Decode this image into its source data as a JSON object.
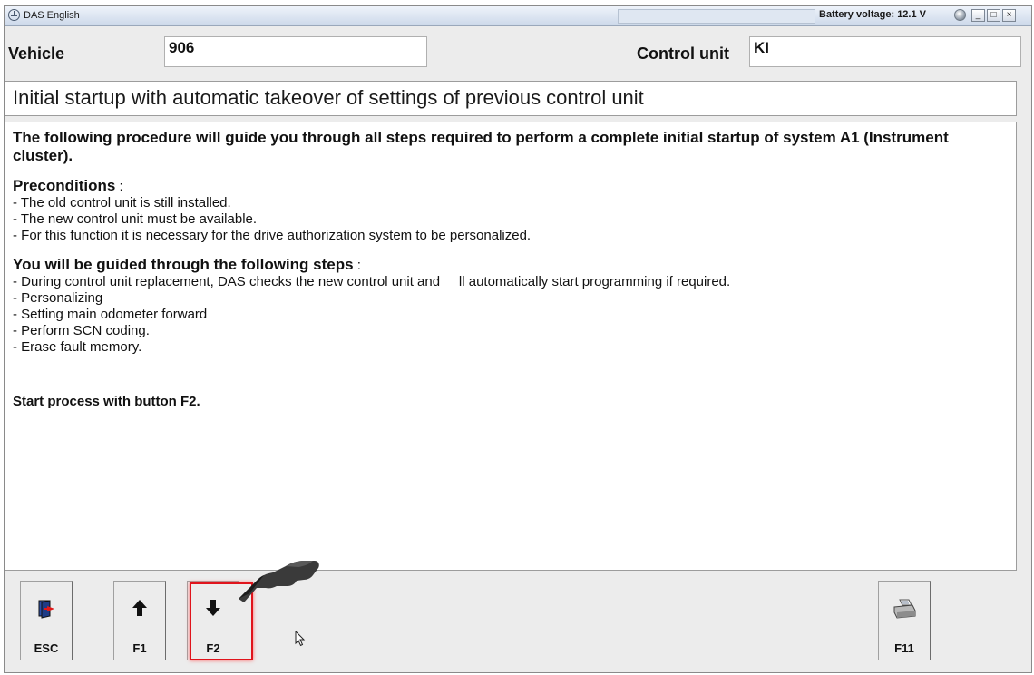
{
  "titlebar": {
    "app_title": "DAS English",
    "battery": "Battery voltage: 12.1 V",
    "min_glyph": "_",
    "max_glyph": "□",
    "close_glyph": "×"
  },
  "header": {
    "vehicle_label": "Vehicle",
    "vehicle_value": "906",
    "control_unit_label": "Control unit",
    "control_unit_value": "KI"
  },
  "procedure_title": "Initial startup with automatic takeover of settings of previous control unit",
  "content": {
    "intro": "The following procedure will guide you through all steps required to perform a complete initial startup of system A1 (Instrument cluster).",
    "preconditions_title": "Preconditions",
    "preconditions_suffix": " :",
    "preconditions": [
      "- The old control unit is still installed.",
      "- The new control unit must be available.",
      "- For this function it is necessary for the drive authorization system to be personalized."
    ],
    "steps_title": "You will be guided through the following steps",
    "steps_suffix": " :",
    "steps": [
      "- During control unit replacement, DAS checks the new control unit and     ll automatically start programming if required.",
      "- Personalizing",
      "- Setting main odometer forward",
      "- Perform SCN coding.",
      "- Erase fault memory."
    ],
    "start_text": "Start process with button F2."
  },
  "buttons": {
    "esc": "ESC",
    "f1": "F1",
    "f2": "F2",
    "f11": "F11"
  },
  "icons": {
    "esc": "exit-door-icon",
    "f1": "arrow-up-icon",
    "f2": "arrow-down-icon",
    "f11": "printer-icon",
    "pointer": "pointing-hand-icon",
    "cursor": "mouse-cursor-icon"
  },
  "colors": {
    "highlight": "#e0141c",
    "background": "#ececec"
  }
}
